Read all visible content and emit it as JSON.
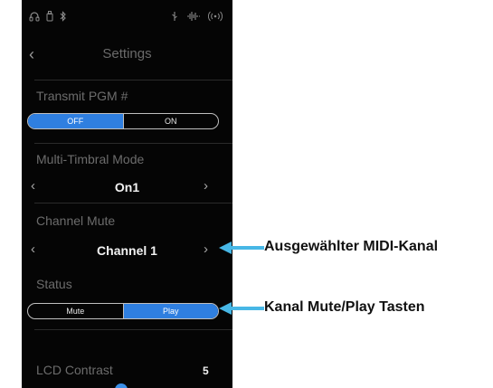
{
  "status_icons": [
    "headphones-icon",
    "usb-icon",
    "bluetooth-icon",
    "usb-symbol-icon",
    "audio-icon",
    "wireless-icon"
  ],
  "header": {
    "title": "Settings",
    "back_icon": "chevron-left-icon"
  },
  "transmit_pgm": {
    "label": "Transmit PGM #",
    "options": [
      "OFF",
      "ON"
    ],
    "selected": "OFF"
  },
  "multi_timbral": {
    "label": "Multi-Timbral Mode",
    "value": "On1"
  },
  "channel_mute": {
    "label": "Channel Mute",
    "value": "Channel 1"
  },
  "status": {
    "label": "Status",
    "options": [
      "Mute",
      "Play"
    ],
    "selected": "Play"
  },
  "lcd_contrast": {
    "label": "LCD Contrast",
    "value": "5"
  },
  "annotations": {
    "midi_channel": "Ausgewählter MIDI-Kanal",
    "mute_play": "Kanal Mute/Play Tasten"
  },
  "colors": {
    "accent": "#2f7fe0",
    "arrow": "#47b7e6",
    "background": "#050505"
  }
}
